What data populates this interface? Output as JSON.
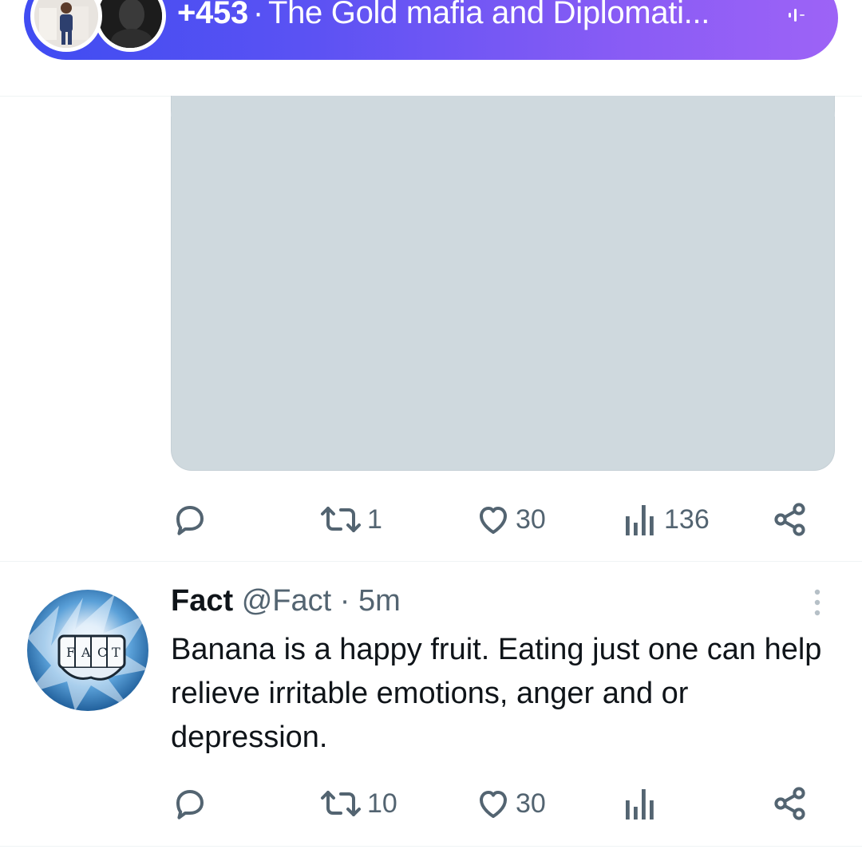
{
  "spaces": {
    "listener_count": "+453",
    "separator": "·",
    "title": "The Gold mafia and Diplomati..."
  },
  "tweet1": {
    "actions": {
      "reply": "",
      "retweet": "1",
      "like": "30",
      "views": "136"
    }
  },
  "tweet2": {
    "name": "Fact",
    "handle": "@Fact",
    "separator": "·",
    "time": "5m",
    "text": "Banana is a happy fruit. Eating just one can help relieve irritable emotions, anger and or depression.",
    "avatar_text": "FACT",
    "actions": {
      "reply": "",
      "retweet": "10",
      "like": "30",
      "views": ""
    }
  },
  "colors": {
    "spaces_gradient_start": "#3f4cf2",
    "spaces_gradient_end": "#9d63f6",
    "icon_gray": "#536471",
    "media_placeholder": "#cfd9de"
  }
}
